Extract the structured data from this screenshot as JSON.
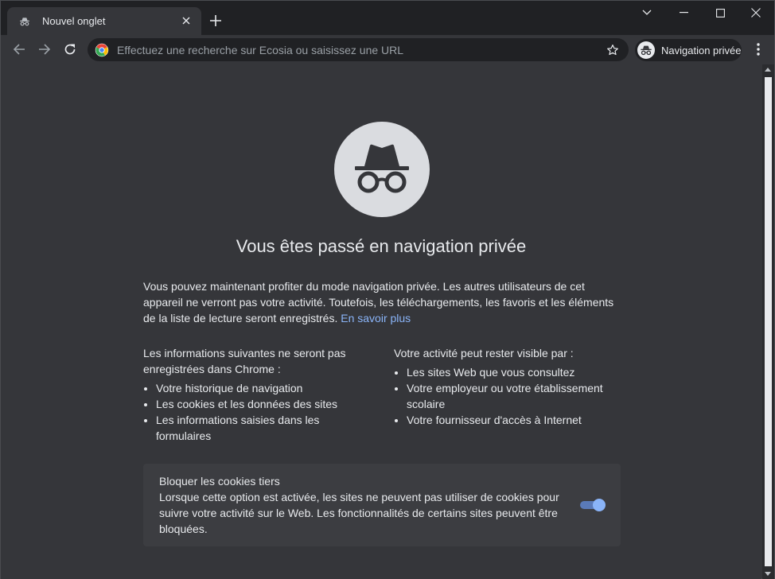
{
  "tab": {
    "title": "Nouvel onglet",
    "icon": "incognito-icon"
  },
  "window_controls": [
    "chevron-down-icon",
    "minimize-icon",
    "maximize-icon",
    "close-icon"
  ],
  "omnibox": {
    "placeholder": "Effectuez une recherche sur Ecosia ou saisissez une URL",
    "value": ""
  },
  "profile_chip": {
    "label": "Navigation privée"
  },
  "page": {
    "headline": "Vous êtes passé en navigation privée",
    "intro": "Vous pouvez maintenant profiter du mode navigation privée. Les autres utilisateurs de cet appareil ne verront pas votre activité. Toutefois, les téléchargements, les favoris et les éléments de la liste de lecture seront enregistrés.",
    "learn_more": "En savoir plus",
    "not_saved": {
      "heading": "Les informations suivantes ne seront pas enregistrées dans Chrome :",
      "items": [
        "Votre historique de navigation",
        "Les cookies et les données des sites",
        "Les informations saisies dans les formulaires"
      ]
    },
    "visible_to": {
      "heading": "Votre activité peut rester visible par :",
      "items": [
        "Les sites Web que vous consultez",
        "Votre employeur ou votre établissement scolaire",
        "Votre fournisseur d'accès à Internet"
      ]
    },
    "cookies": {
      "title": "Bloquer les cookies tiers",
      "description": "Lorsque cette option est activée, les sites ne peuvent pas utiliser de cookies pour suivre votre activité sur le Web. Les fonctionnalités de certains sites peuvent être bloquées.",
      "enabled": true
    }
  },
  "colors": {
    "accent": "#8ab4f8",
    "background": "#35363a",
    "frame": "#202124"
  }
}
